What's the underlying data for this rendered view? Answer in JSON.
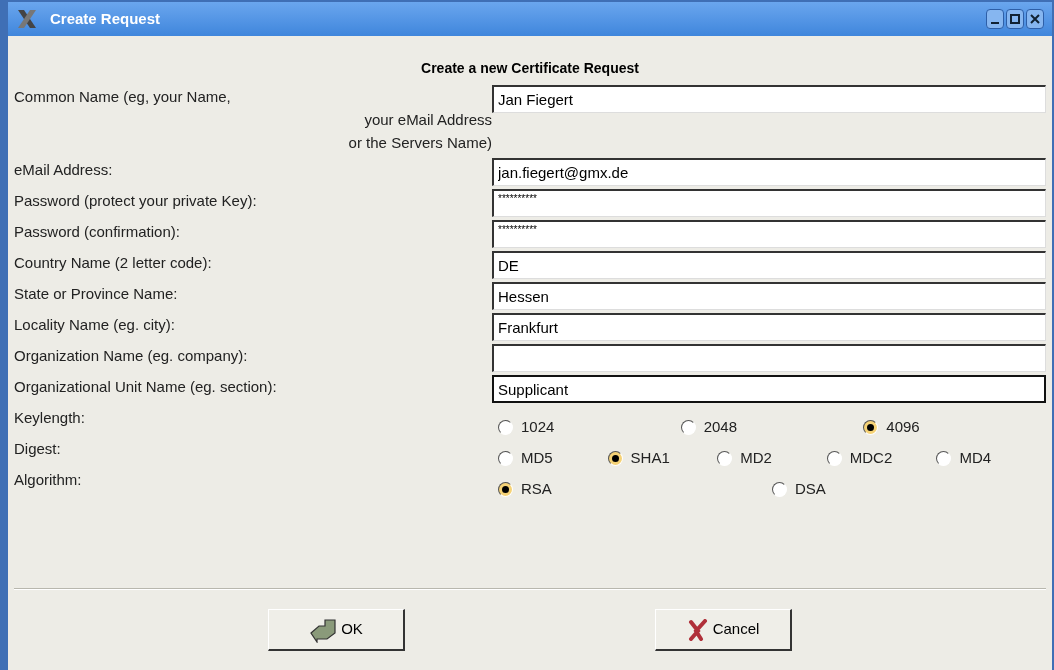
{
  "window": {
    "title": "Create Request"
  },
  "heading": "Create a new Certificate Request",
  "fields": [
    {
      "label": "Common Name (eg, your Name,",
      "label_continuation": [
        "your eMail Address",
        "or the Servers Name)"
      ],
      "value": "Jan Fiegert",
      "focused": false,
      "kind": "text"
    },
    {
      "label": "eMail Address:",
      "value": "jan.fiegert@gmx.de",
      "focused": false,
      "kind": "text"
    },
    {
      "label": "Password (protect your private Key):",
      "value": "**********",
      "focused": false,
      "kind": "password"
    },
    {
      "label": "Password (confirmation):",
      "value": "**********",
      "focused": false,
      "kind": "password"
    },
    {
      "label": "Country Name (2 letter code):",
      "value": "DE",
      "focused": false,
      "kind": "text"
    },
    {
      "label": "State or Province Name:",
      "value": "Hessen",
      "focused": false,
      "kind": "text"
    },
    {
      "label": "Locality Name (eg. city):",
      "value": "Frankfurt",
      "focused": false,
      "kind": "text"
    },
    {
      "label": "Organization Name (eg. company):",
      "focused": false,
      "kind": "text"
    },
    {
      "label": "Organizational Unit Name (eg. section):",
      "value": "Supplicant",
      "focused": true,
      "kind": "text"
    }
  ],
  "choices": [
    {
      "label": "Keylength:",
      "options": [
        {
          "label": "1024",
          "selected": false
        },
        {
          "label": "2048",
          "selected": false
        },
        {
          "label": "4096",
          "selected": true
        }
      ]
    },
    {
      "label": "Digest:",
      "options": [
        {
          "label": "MD5",
          "selected": false
        },
        {
          "label": "SHA1",
          "selected": true
        },
        {
          "label": "MD2",
          "selected": false
        },
        {
          "label": "MDC2",
          "selected": false
        },
        {
          "label": "MD4",
          "selected": false
        }
      ]
    },
    {
      "label": "Algorithm:",
      "options": [
        {
          "label": "RSA",
          "selected": true
        },
        {
          "label": "DSA",
          "selected": false
        }
      ]
    }
  ],
  "buttons": [
    {
      "label": "OK",
      "kind": "ok"
    },
    {
      "label": "Cancel",
      "kind": "cancel"
    }
  ]
}
